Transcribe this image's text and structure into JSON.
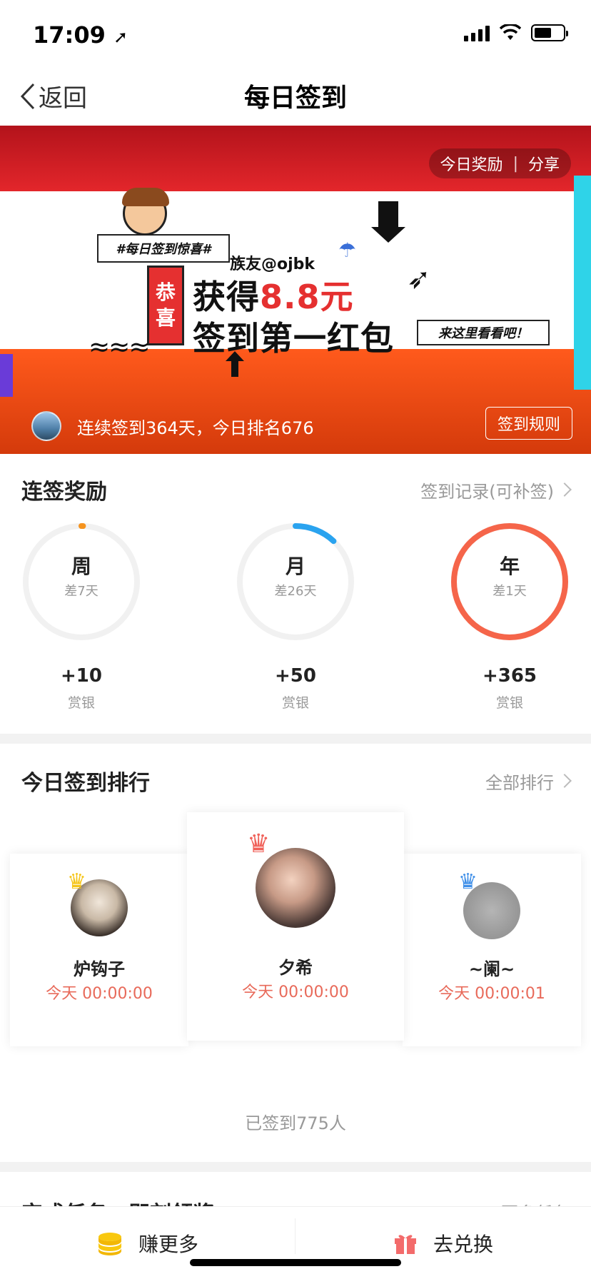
{
  "status_bar": {
    "time": "17:09"
  },
  "nav": {
    "back_label": "返回",
    "title": "每日签到"
  },
  "banner": {
    "tab_reward": "今日奖励",
    "tab_divider": "|",
    "tab_share": "分享",
    "promo_tag": "#每日签到惊喜#",
    "promo_user": "族友@ojbk",
    "promo_gong_1": "恭",
    "promo_gong_2": "喜",
    "promo_got": "获得",
    "promo_amount": "8.8元",
    "promo_line2": "签到第一红包",
    "promo_look": "来这里看看吧！",
    "streak_text": "连续签到364天，今日排名676",
    "rules_label": "签到规则"
  },
  "streak_rewards": {
    "title": "连签奖励",
    "link": "签到记录(可补签)",
    "items": [
      {
        "label": "周",
        "sub": "差7天",
        "reward": "+10",
        "unit": "赏银",
        "progress": 0.0,
        "color": "#f5931e"
      },
      {
        "label": "月",
        "sub": "差26天",
        "reward": "+50",
        "unit": "赏银",
        "progress": 0.12,
        "color": "#2aa3ef"
      },
      {
        "label": "年",
        "sub": "差1天",
        "reward": "+365",
        "unit": "赏银",
        "progress": 1.0,
        "color": "#f5654a"
      }
    ]
  },
  "ranking": {
    "title": "今日签到排行",
    "link": "全部排行",
    "first": {
      "name": "夕希",
      "time": "今天 00:00:00"
    },
    "second": {
      "name": "炉钩子",
      "time": "今天 00:00:00"
    },
    "third": {
      "name": "~阑~",
      "time": "今天 00:00:01"
    },
    "signed_count": "已签到775人"
  },
  "tasks": {
    "title": "完成任务，即刻领奖",
    "link": "更多任务"
  },
  "bottom_bar": {
    "earn_label": "赚更多",
    "exchange_label": "去兑换"
  },
  "colors": {
    "accent_red": "#e53030",
    "rank_time": "#e86a5a"
  }
}
